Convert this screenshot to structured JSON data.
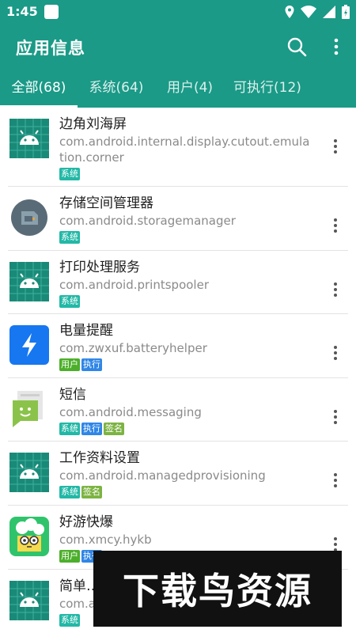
{
  "status_bar": {
    "time": "1:45"
  },
  "app_bar": {
    "title": "应用信息"
  },
  "tabs": [
    {
      "label": "全部(68)",
      "active": true
    },
    {
      "label": "系统(64)",
      "active": false
    },
    {
      "label": "用户(4)",
      "active": false
    },
    {
      "label": "可执行(12)",
      "active": false
    }
  ],
  "badge_colors": {
    "系统": "#22b8a6",
    "用户": "#4caf2a",
    "执行": "#2f86e6",
    "签名": "#7cb342"
  },
  "apps": [
    {
      "title": "边角刘海屏",
      "package": "com.android.internal.display.cutout.emulation.corner",
      "icon": "android-icon",
      "badges": [
        "系统"
      ]
    },
    {
      "title": "存储空间管理器",
      "package": "com.android.storagemanager",
      "icon": "storage-icon",
      "badges": [
        "系统"
      ]
    },
    {
      "title": "打印处理服务",
      "package": "com.android.printspooler",
      "icon": "android-icon",
      "badges": [
        "系统"
      ]
    },
    {
      "title": "电量提醒",
      "package": "com.zwxuf.batteryhelper",
      "icon": "lightning-icon",
      "badges": [
        "用户",
        "执行"
      ]
    },
    {
      "title": "短信",
      "package": "com.android.messaging",
      "icon": "messaging-icon",
      "badges": [
        "系统",
        "执行",
        "签名"
      ]
    },
    {
      "title": "工作资料设置",
      "package": "com.android.managedprovisioning",
      "icon": "android-icon",
      "badges": [
        "系统",
        "签名"
      ]
    },
    {
      "title": "好游快爆",
      "package": "com.xmcy.hykb",
      "icon": "game-icon",
      "badges": [
        "用户",
        "执行"
      ]
    },
    {
      "title": "简单…",
      "package": "com.a…",
      "icon": "android-icon",
      "badges": [
        "系统"
      ]
    }
  ],
  "watermark": "下载鸟资源"
}
